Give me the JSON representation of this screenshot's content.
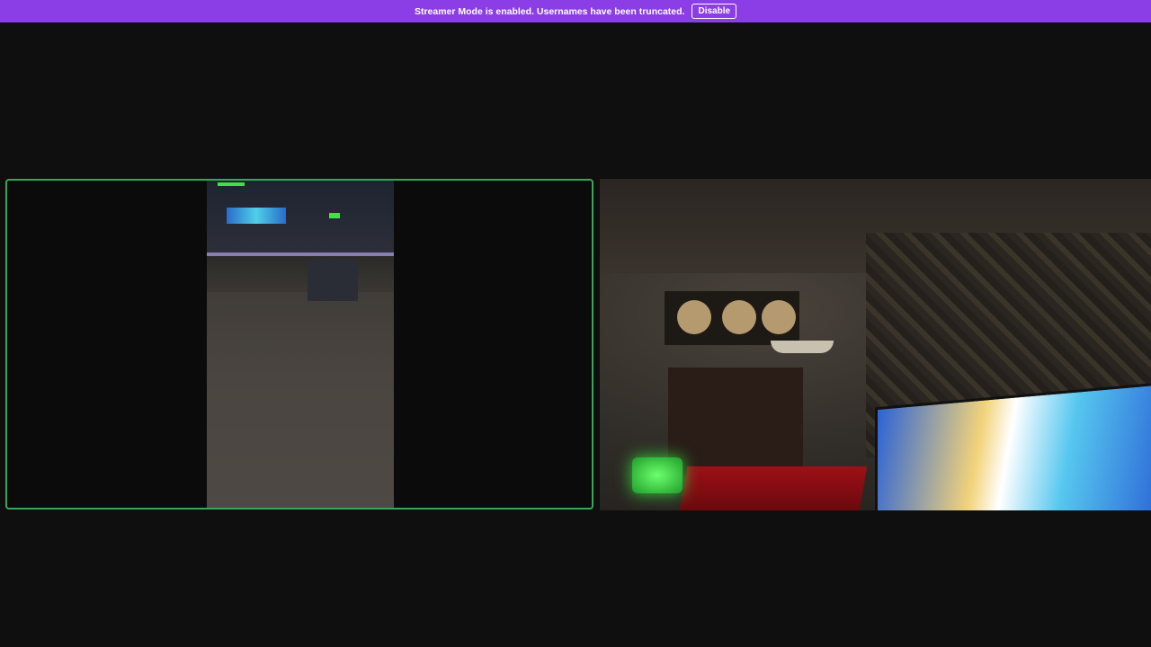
{
  "notice": {
    "message": "Streamer Mode is enabled. Usernames have been truncated.",
    "button_label": "Disable",
    "background_color": "#8b3ee6"
  },
  "video_grid": {
    "tiles": [
      {
        "id": "participant-1",
        "speaking": true,
        "border_color": "#3ba55c"
      },
      {
        "id": "participant-2",
        "speaking": false
      }
    ]
  }
}
